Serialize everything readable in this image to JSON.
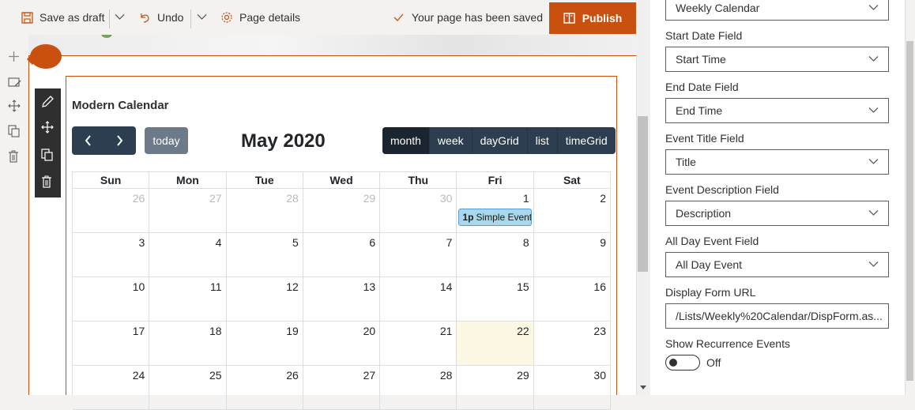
{
  "commandbar": {
    "save_draft": "Save as draft",
    "undo": "Undo",
    "page_details": "Page details",
    "saved_status": "Your page has been saved",
    "publish": "Publish",
    "accent_color": "#ca5010"
  },
  "webpart": {
    "title": "Modern Calendar"
  },
  "calendar": {
    "today_label": "today",
    "title": "May 2020",
    "views": [
      "month",
      "week",
      "dayGrid",
      "list",
      "timeGrid"
    ],
    "active_view": "month",
    "days_of_week": [
      "Sun",
      "Mon",
      "Tue",
      "Wed",
      "Thu",
      "Fri",
      "Sat"
    ],
    "weeks": [
      [
        {
          "n": "26",
          "other": true
        },
        {
          "n": "27",
          "other": true
        },
        {
          "n": "28",
          "other": true
        },
        {
          "n": "29",
          "other": true
        },
        {
          "n": "30",
          "other": true
        },
        {
          "n": "1"
        },
        {
          "n": "2"
        }
      ],
      [
        {
          "n": "3"
        },
        {
          "n": "4"
        },
        {
          "n": "5"
        },
        {
          "n": "6"
        },
        {
          "n": "7"
        },
        {
          "n": "8"
        },
        {
          "n": "9"
        }
      ],
      [
        {
          "n": "10"
        },
        {
          "n": "11"
        },
        {
          "n": "12"
        },
        {
          "n": "13"
        },
        {
          "n": "14"
        },
        {
          "n": "15"
        },
        {
          "n": "16"
        }
      ],
      [
        {
          "n": "17"
        },
        {
          "n": "18"
        },
        {
          "n": "19"
        },
        {
          "n": "20"
        },
        {
          "n": "21"
        },
        {
          "n": "22",
          "today": true
        },
        {
          "n": "23"
        }
      ],
      [
        {
          "n": "24"
        },
        {
          "n": "25"
        },
        {
          "n": "26"
        },
        {
          "n": "27"
        },
        {
          "n": "28"
        },
        {
          "n": "29"
        },
        {
          "n": "30"
        }
      ]
    ],
    "event": {
      "time": "1p",
      "title": "Simple Event",
      "date": "1"
    }
  },
  "pane": {
    "list_value": "Weekly Calendar",
    "fields": [
      {
        "label": "Start Date Field",
        "value": "Start Time"
      },
      {
        "label": "End Date Field",
        "value": "End Time"
      },
      {
        "label": "Event Title Field",
        "value": "Title"
      },
      {
        "label": "Event Description Field",
        "value": "Description"
      },
      {
        "label": "All Day Event Field",
        "value": "All Day Event"
      }
    ],
    "display_form_label": "Display Form URL",
    "display_form_value": "/Lists/Weekly%20Calendar/DispForm.as...",
    "recurrence_label": "Show Recurrence Events",
    "recurrence_value": "Off"
  }
}
